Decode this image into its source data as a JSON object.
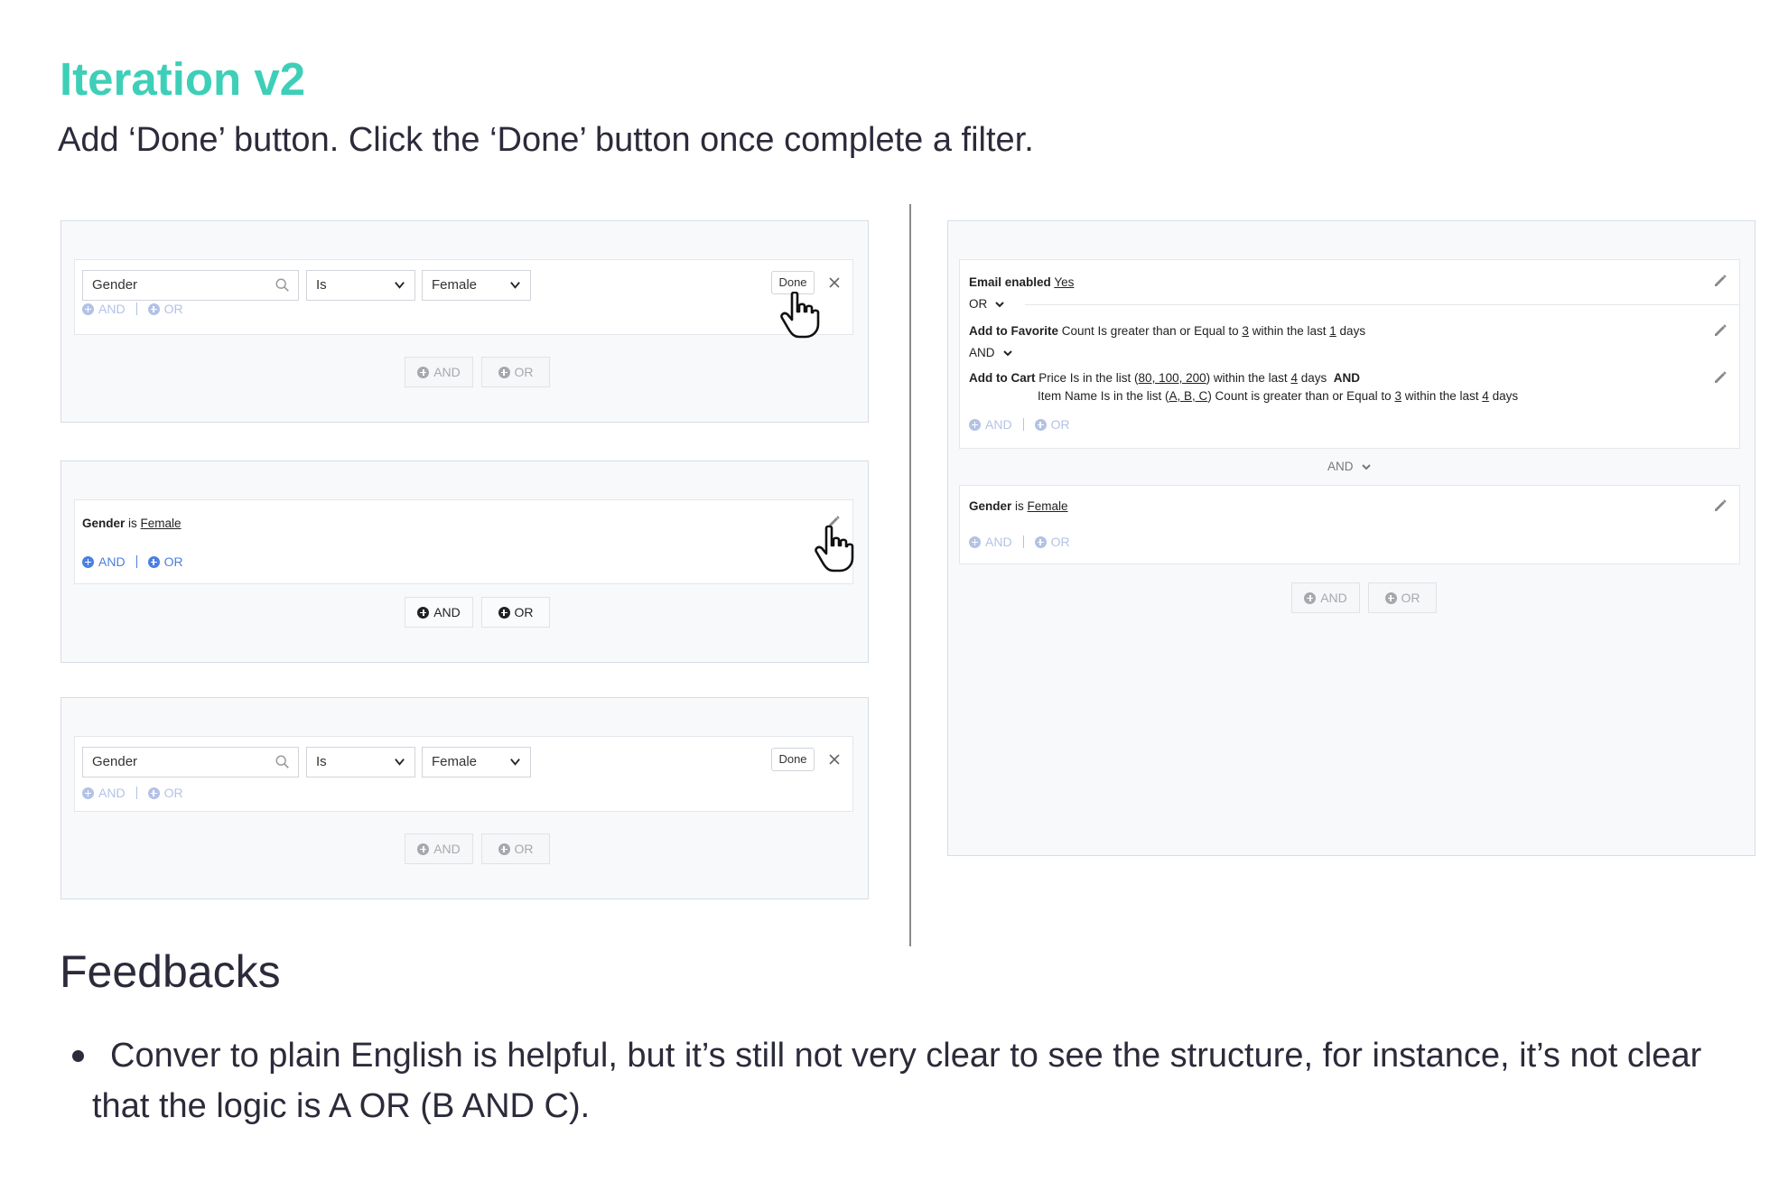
{
  "page": {
    "title": "Iteration v2",
    "subtitle": "Add ‘Done’ button. Click the ‘Done’ button once complete a filter."
  },
  "editor": {
    "field_value": "Gender",
    "operator_value": "Is",
    "value_value": "Female",
    "done_label": "Done"
  },
  "logic": {
    "and": "AND",
    "or": "OR"
  },
  "summary_gender": {
    "field": "Gender",
    "op": "is",
    "value": "Female"
  },
  "right": {
    "row1": {
      "field": "Email enabled",
      "value": "Yes"
    },
    "or_label": "OR",
    "row2": {
      "field": "Add to Favorite",
      "t1": "Count Is greater than or Equal to",
      "v1": "3",
      "t2": "within the last",
      "v2": "1",
      "t3": "days"
    },
    "and_label": "AND",
    "row3": {
      "field": "Add to Cart",
      "t1": "Price Is in the list (",
      "v1": "80, 100, 200",
      "t2": ") within the last",
      "v2": "4",
      "t3": "days",
      "and": "AND",
      "t4": "Item Name Is in the list (",
      "v3": "A, B, C",
      "t5": ") Count is greater than or Equal to",
      "v4": "3",
      "t6": "within the last",
      "v5": "4",
      "t7": "days"
    },
    "group_and_label": "AND",
    "row4": {
      "field": "Gender",
      "op": "is",
      "value": "Female"
    }
  },
  "feedback": {
    "heading": "Feedbacks",
    "item": "Conver to plain English is helpful, but it’s still not very clear to see the structure, for instance, it’s not clear that the logic is A OR (B AND C)."
  },
  "colors": {
    "title": "#3ecfb8",
    "link_blue": "#4b7fe0",
    "faded_blue": "#b3c2e4",
    "panel_border": "#d5dde6"
  },
  "icons": [
    "search-icon",
    "chevron-down-icon",
    "close-icon",
    "plus-circle-icon",
    "pencil-icon",
    "hand-cursor-icon"
  ]
}
